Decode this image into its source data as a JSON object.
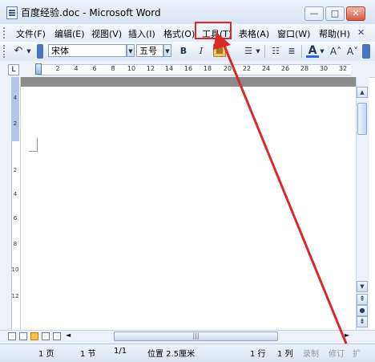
{
  "window": {
    "title": "百度经验.doc - Microsoft Word",
    "controls": {
      "minimize": "—",
      "maximize": "□",
      "close": "✕"
    }
  },
  "menubar": {
    "items": [
      {
        "label": "文件(F)"
      },
      {
        "label": "编辑(E)"
      },
      {
        "label": "视图(V)"
      },
      {
        "label": "插入(I)"
      },
      {
        "label": "格式(O)"
      },
      {
        "label": "工具(T)"
      },
      {
        "label": "表格(A)"
      },
      {
        "label": "窗口(W)"
      },
      {
        "label": "帮助(H)"
      }
    ],
    "highlighted_item": "工具(T)",
    "highlight_color": "#d92a2a"
  },
  "toolbar": {
    "font": "宋体",
    "font_size": "五号",
    "bold": "B",
    "italic": "I",
    "font_color_letter": "A",
    "grow_font": "A˄",
    "icons": [
      "undo-icon",
      "style-icon",
      "highlight-icon",
      "line-spacing-icon",
      "bullets-icon",
      "numbering-icon",
      "font-color-icon"
    ]
  },
  "ruler": {
    "tab_selector": "L",
    "horizontal_ticks": [
      "2",
      "4",
      "6",
      "8",
      "10",
      "12",
      "14",
      "16",
      "18",
      "20",
      "22",
      "24",
      "26",
      "28",
      "30",
      "32"
    ],
    "vertical_ticks": [
      "4",
      "2",
      "2",
      "4",
      "6",
      "8",
      "10",
      "12"
    ]
  },
  "scrollbar": {
    "thumb_grip": "|||"
  },
  "statusbar": {
    "page": "1 页",
    "section": "1 节",
    "page_of": "1/1",
    "position": "位置 2.5厘米",
    "line": "1 行",
    "column": "1 列",
    "record": "录制",
    "revision": "修订",
    "extend": "扩"
  },
  "annotation": {
    "arrow_color": "#d92a2a"
  }
}
